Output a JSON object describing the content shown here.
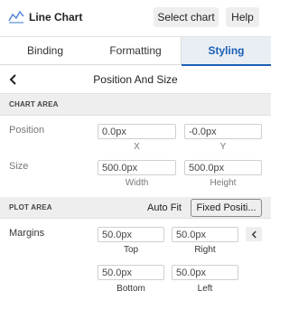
{
  "app": {
    "title": "Line Chart",
    "select_chart_label": "Select chart",
    "help_label": "Help"
  },
  "tabs": [
    {
      "label": "Binding",
      "active": false
    },
    {
      "label": "Formatting",
      "active": false
    },
    {
      "label": "Styling",
      "active": true
    }
  ],
  "panel": {
    "title": "Position And Size"
  },
  "chart_area": {
    "heading": "CHART AREA",
    "position": {
      "label": "Position",
      "x_value": "0.0px",
      "y_value": "-0.0px",
      "x_caption": "X",
      "y_caption": "Y"
    },
    "size": {
      "label": "Size",
      "width_value": "500.0px",
      "height_value": "500.0px",
      "width_caption": "Width",
      "height_caption": "Height"
    }
  },
  "plot_area": {
    "heading": "PLOT AREA",
    "auto_fit_label": "Auto Fit",
    "fixed_position_label": "Fixed Positi...",
    "margins": {
      "label": "Margins",
      "top_value": "50.0px",
      "right_value": "50.0px",
      "bottom_value": "50.0px",
      "left_value": "50.0px",
      "top_caption": "Top",
      "right_caption": "Right",
      "bottom_caption": "Bottom",
      "left_caption": "Left"
    }
  },
  "icons": {
    "app": "line-chart-icon",
    "back": "chevron-left-icon",
    "collapse": "chevron-left-icon"
  },
  "colors": {
    "accent": "#1a5fb4",
    "active_tab_bg": "#e9eef5",
    "section_bg": "#eeeeee"
  }
}
